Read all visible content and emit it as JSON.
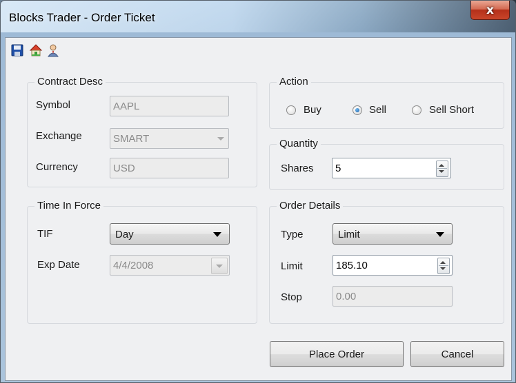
{
  "window": {
    "title": "Blocks Trader - Order Ticket",
    "close_label": "x"
  },
  "toolbar": {
    "icons": [
      "save-icon",
      "home-icon",
      "user-icon"
    ]
  },
  "contract": {
    "legend": "Contract Desc",
    "symbol_label": "Symbol",
    "symbol_value": "AAPL",
    "exchange_label": "Exchange",
    "exchange_value": "SMART",
    "currency_label": "Currency",
    "currency_value": "USD"
  },
  "action": {
    "legend": "Action",
    "options": [
      "Buy",
      "Sell",
      "Sell Short"
    ],
    "selected": "Sell"
  },
  "quantity": {
    "legend": "Quantity",
    "shares_label": "Shares",
    "shares_value": "5"
  },
  "tif": {
    "legend": "Time In Force",
    "tif_label": "TIF",
    "tif_value": "Day",
    "exp_label": "Exp Date",
    "exp_value": "4/4/2008"
  },
  "order_details": {
    "legend": "Order Details",
    "type_label": "Type",
    "type_value": "Limit",
    "limit_label": "Limit",
    "limit_value": "185.10",
    "stop_label": "Stop",
    "stop_value": "0.00"
  },
  "buttons": {
    "place_order": "Place Order",
    "cancel": "Cancel"
  },
  "colors": {
    "accent_radio": "#1a5fa8",
    "close_button": "#c8452a"
  }
}
